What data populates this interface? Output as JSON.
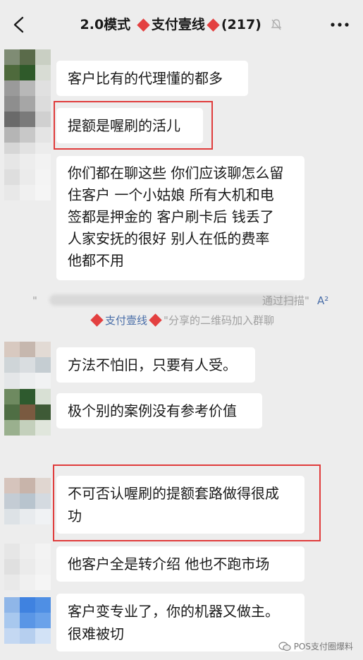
{
  "header": {
    "title": "2.0模式",
    "group_name": "支付壹线",
    "member_count": "(217)",
    "back_icon": "chevron-left-icon",
    "mute_icon": "bell-muted-icon",
    "more_icon": "more-dots-icon"
  },
  "messages": [
    {
      "text": "客户比有的代理懂的都多"
    },
    {
      "text": "提额是喔刷的活儿"
    },
    {
      "line1": "你们都在聊这些 你们应该聊怎么留",
      "line2": "住客户 一个小姑娘 所有大机和电",
      "line3": "签都是押金的 客户刷卡后 钱丢了",
      "line4": "人家安抚的很好  别人在低的费率",
      "line5": "他都不用"
    },
    {
      "text": "方法不怕旧，只要有人受。"
    },
    {
      "text": "极个别的案例没有参考价值"
    },
    {
      "line1": "不可否认喔刷的提额套路做得很成",
      "line2": "功"
    },
    {
      "text": "他客户全是转介绍 他也不跑市场"
    },
    {
      "line1": "客户变专业了，你的机器又做主。",
      "line2": "很难被切"
    }
  ],
  "system_notice": {
    "line1_prefix": "\"",
    "line1_suffix": "通过扫描\"",
    "line1_mark": "A²",
    "line2_name": "支付壹线",
    "line2_text": "\"分享的二维码加入群聊"
  },
  "watermark": "POS支付圈爆料",
  "colors": {
    "highlight": "#e03c3c",
    "diamond": "#e34040",
    "background": "#ededed",
    "bubble": "#ffffff"
  }
}
